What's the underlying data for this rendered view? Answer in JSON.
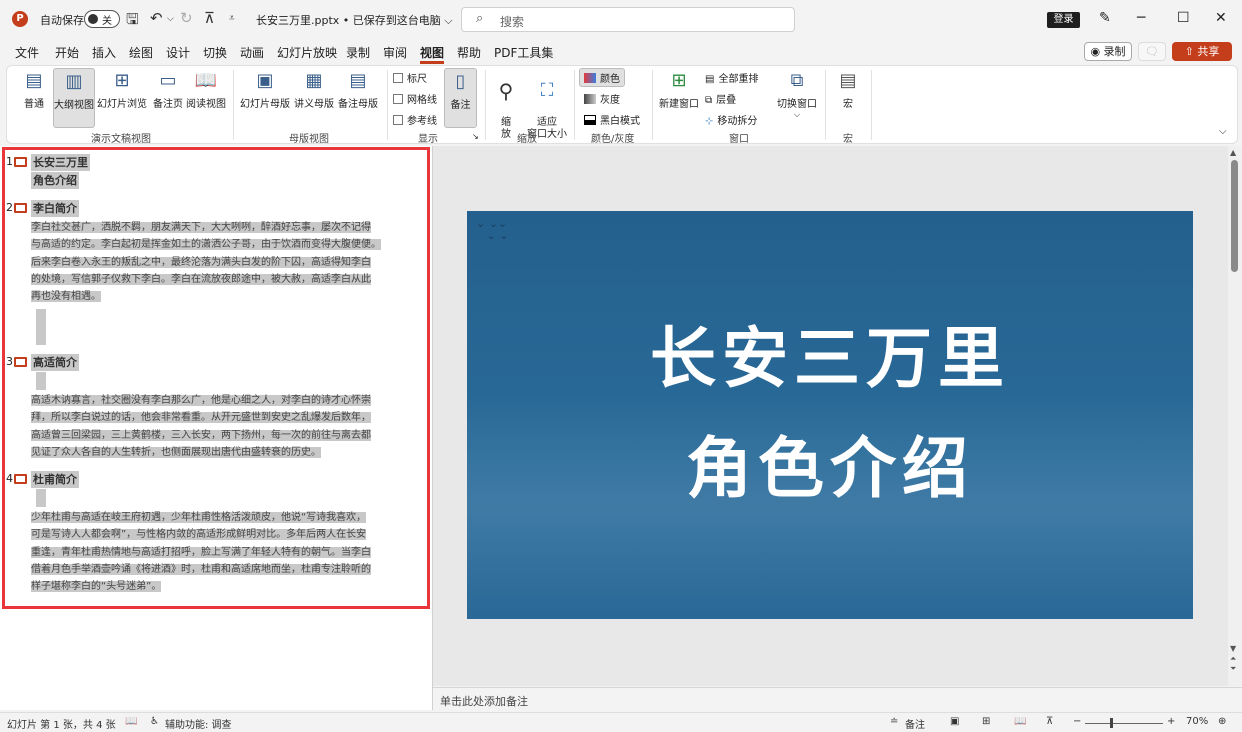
{
  "titlebar": {
    "logo": "P",
    "autosave_label": "自动保存",
    "autosave_state": "关",
    "doc_title": "长安三万里.pptx • 已保存到这台电脑 ⌵",
    "search_placeholder": "搜索",
    "login": "登录"
  },
  "menu": {
    "tabs": [
      "文件",
      "开始",
      "插入",
      "绘图",
      "设计",
      "切换",
      "动画",
      "幻灯片放映",
      "录制",
      "审阅",
      "视图",
      "帮助",
      "PDF工具集"
    ],
    "active": "视图",
    "record": "◉ 录制",
    "share": "⇧ 共享"
  },
  "ribbon": {
    "views": [
      "普通",
      "大纲视图",
      "幻灯片浏览",
      "备注页",
      "阅读视图"
    ],
    "views_group": "演示文稿视图",
    "masters": [
      "幻灯片母版",
      "讲义母版",
      "备注母版"
    ],
    "masters_group": "母版视图",
    "show": [
      "标尺",
      "网格线",
      "参考线"
    ],
    "notes": "备注",
    "show_group": "显示",
    "zoom": "缩\n放",
    "fit": "适应\n窗口大小",
    "zoom_group": "缩放",
    "color": "颜色",
    "gray": "灰度",
    "bw": "黑白模式",
    "color_group": "颜色/灰度",
    "new_window": "新建窗口",
    "arrange_all": "全部重排",
    "cascade": "层叠",
    "move_split": "移动拆分",
    "switch_window": "切换窗口",
    "window_group": "窗口",
    "macro": "宏",
    "macro_group": "宏"
  },
  "outline": {
    "slides": [
      {
        "num": "1",
        "title": "长安三万里",
        "subtitle": "角色介绍"
      },
      {
        "num": "2",
        "title": "李白简介",
        "body": [
          "李白社交甚广，洒脱不羁，朋友满天下，大大咧咧，醉酒好忘事，屡次不记得",
          "与高适的约定。李白起初是挥金如土的潇洒公子哥，由于饮酒而变得大腹便便。",
          "后来李白卷入永王的叛乱之中，最终沦落为满头白发的阶下囚，高适得知李白",
          "的处境，写信郭子仪救下李白。李白在流放夜郎途中，被大赦，高适李白从此",
          "再也没有相遇。"
        ]
      },
      {
        "num": "3",
        "title": "高适简介",
        "body": [
          "高适木讷寡言，社交圈没有李白那么广，他是心细之人，对李白的诗才心怀崇",
          "拜，所以李白说过的话，他会非常看重。从开元盛世到安史之乱爆发后数年，",
          "高适曾三回梁园，三上黄鹤楼，三入长安，两下扬州，每一次的前往与离去都",
          "见证了众人各自的人生转折，也侧面展现出唐代由盛转衰的历史。"
        ]
      },
      {
        "num": "4",
        "title": "杜甫简介",
        "body": [
          "少年杜甫与高适在岐王府初遇，少年杜甫性格活泼顽皮，他说“写诗我喜欢，",
          "可是写诗人人都会啊”，与性格内敛的高适形成鲜明对比。多年后两人在长安",
          "重逢，青年杜甫热情地与高适打招呼，脸上写满了年轻人特有的朝气。当李白",
          "借着月色手举酒壶吟诵《将进酒》时，杜甫和高适席地而坐，杜甫专注聆听的",
          "样子堪称李白的“头号迷弟”。"
        ]
      }
    ]
  },
  "slide": {
    "line1": "长安三万里",
    "line2": "角色介绍"
  },
  "notes_placeholder": "单击此处添加备注",
  "status": {
    "slide_info": "幻灯片 第 1 张，共 4 张",
    "accessibility": "辅助功能: 调查",
    "notes": "备注",
    "zoom": "70%"
  }
}
